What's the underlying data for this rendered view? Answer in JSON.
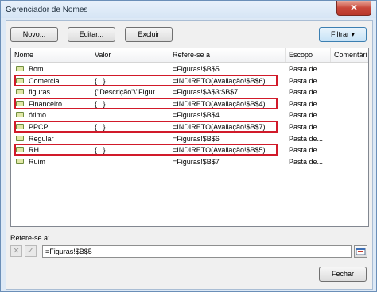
{
  "window": {
    "title": "Gerenciador de Nomes",
    "close_label": "✕"
  },
  "toolbar": {
    "new_label": "Novo...",
    "edit_label": "Editar...",
    "delete_label": "Excluir",
    "filter_label": "Filtrar ▾"
  },
  "table": {
    "columns": [
      "Nome",
      "Valor",
      "Refere-se a",
      "Escopo",
      "Comentári"
    ],
    "rows": [
      {
        "name": "Bom",
        "value": "",
        "refers_to": "=Figuras!$B$5",
        "scope": "Pasta de...",
        "highlighted": false
      },
      {
        "name": "Comercial",
        "value": "{...}",
        "refers_to": "=INDIRETO(Avaliação!$B$6)",
        "scope": "Pasta de...",
        "highlighted": true
      },
      {
        "name": "figuras",
        "value": "{\"Descrição\"\\\"Figur...",
        "refers_to": "=Figuras!$A$3:$B$7",
        "scope": "Pasta de...",
        "highlighted": false
      },
      {
        "name": "Financeiro",
        "value": "{...}",
        "refers_to": "=INDIRETO(Avaliação!$B$4)",
        "scope": "Pasta de...",
        "highlighted": true
      },
      {
        "name": "ótimo",
        "value": "",
        "refers_to": "=Figuras!$B$4",
        "scope": "Pasta de...",
        "highlighted": false
      },
      {
        "name": "PPCP",
        "value": "{...}",
        "refers_to": "=INDIRETO(Avaliação!$B$7)",
        "scope": "Pasta de...",
        "highlighted": true
      },
      {
        "name": "Regular",
        "value": "",
        "refers_to": "=Figuras!$B$6",
        "scope": "Pasta de...",
        "highlighted": false
      },
      {
        "name": "RH",
        "value": "{...}",
        "refers_to": "=INDIRETO(Avaliação!$B$5)",
        "scope": "Pasta de...",
        "highlighted": true
      },
      {
        "name": "Ruim",
        "value": "",
        "refers_to": "=Figuras!$B$7",
        "scope": "Pasta de...",
        "highlighted": false
      }
    ]
  },
  "refers_to_label": "Refere-se a:",
  "refers_to_value": "=Figuras!$B$5",
  "refers_to_icons": {
    "cancel": "✕",
    "confirm": "✓"
  },
  "close_button_label": "Fechar",
  "colors": {
    "highlight": "#d11a2a",
    "title_bg": "#dde9f6"
  }
}
